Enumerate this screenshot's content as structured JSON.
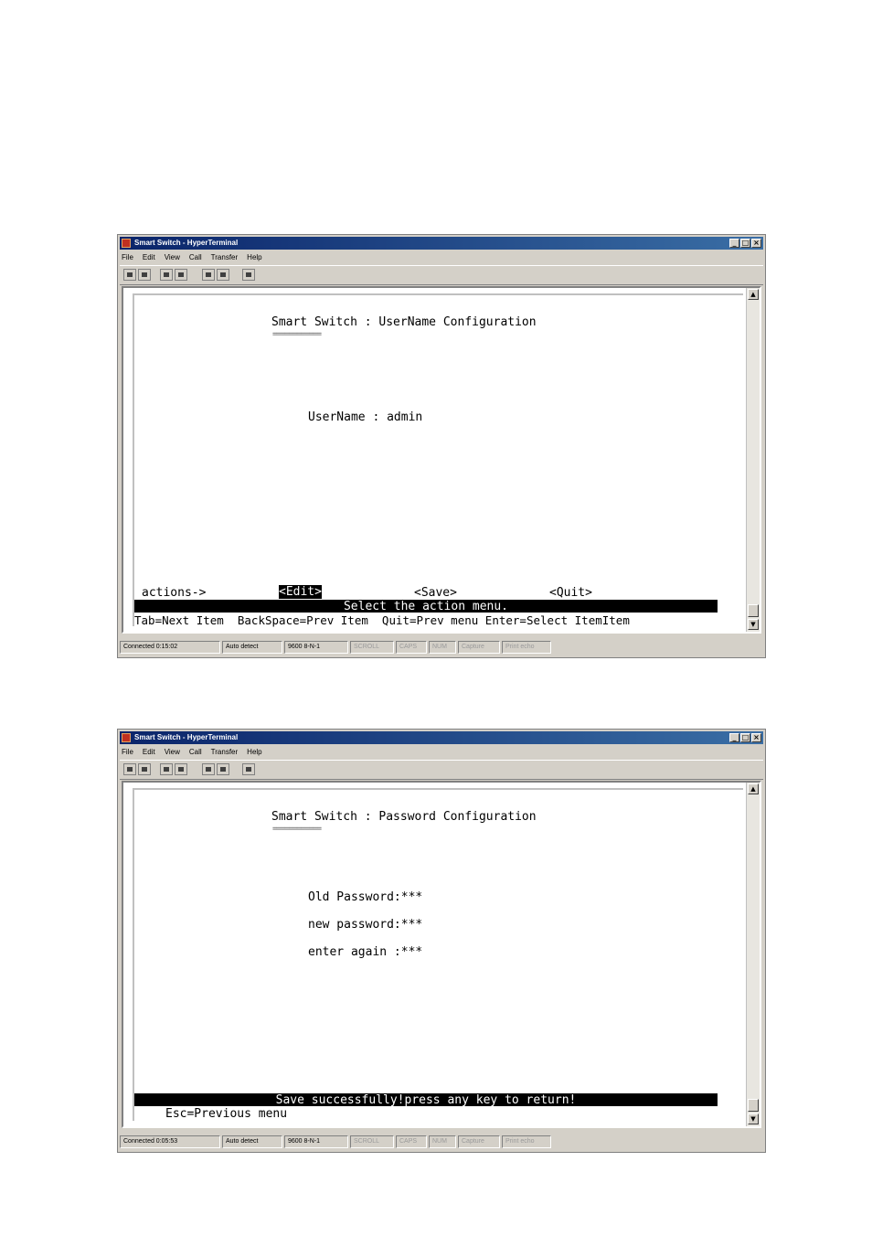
{
  "windows": [
    {
      "title": "Smart Switch - HyperTerminal",
      "menu": [
        "File",
        "Edit",
        "View",
        "Call",
        "Transfer",
        "Help"
      ],
      "screen_title": "Smart Switch : UserName Configuration",
      "title_underline": "============",
      "fields": [
        {
          "label": "UserName",
          "separator": " : ",
          "value": "admin"
        }
      ],
      "actions_label": "actions->",
      "actions": [
        "<Edit>",
        "<Save>",
        "<Quit>"
      ],
      "selected_action": "<Edit>",
      "message": "Select the action menu.",
      "help": "Tab=Next Item  BackSpace=Prev Item  Quit=Prev menu Enter=Select ItemItem",
      "status": [
        "Connected 0:15:02",
        "Auto detect",
        "9600 8-N-1",
        "SCROLL",
        "CAPS",
        "NUM",
        "Capture",
        "Print echo"
      ]
    },
    {
      "title": "Smart Switch - HyperTerminal",
      "menu": [
        "File",
        "Edit",
        "View",
        "Call",
        "Transfer",
        "Help"
      ],
      "screen_title": "Smart Switch : Password Configuration",
      "title_underline": "============",
      "fields": [
        {
          "label": "Old Password",
          "separator": ":",
          "value": "***"
        },
        {
          "label": "new password",
          "separator": ":",
          "value": "***"
        },
        {
          "label": "enter again ",
          "separator": ":",
          "value": "***"
        }
      ],
      "message": "Save successfully!press any key to return!",
      "help": "Esc=Previous menu",
      "status": [
        "Connected 0:05:53",
        "Auto detect",
        "9600 8-N-1",
        "SCROLL",
        "CAPS",
        "NUM",
        "Capture",
        "Print echo"
      ]
    }
  ]
}
